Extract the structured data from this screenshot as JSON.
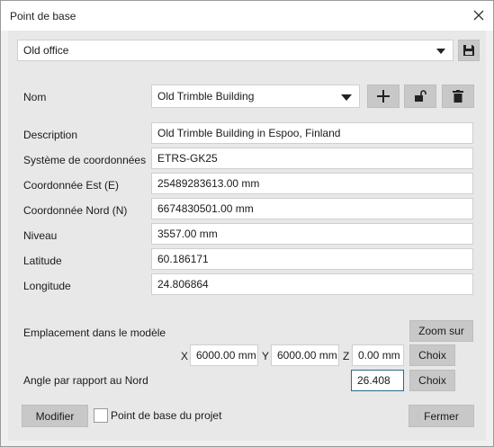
{
  "window": {
    "title": "Point de base"
  },
  "preset": {
    "value": "Old office"
  },
  "form": {
    "name_label": "Nom",
    "name_value": "Old Trimble Building",
    "fields": [
      {
        "label": "Description",
        "value": "Old Trimble Building in Espoo, Finland"
      },
      {
        "label": "Système de coordonnées",
        "value": "ETRS-GK25"
      },
      {
        "label": "Coordonnée Est  (E)",
        "value": "25489283613.00 mm"
      },
      {
        "label": "Coordonnée Nord  (N)",
        "value": "6674830501.00 mm"
      },
      {
        "label": "Niveau",
        "value": "3557.00 mm"
      },
      {
        "label": "Latitude",
        "value": "60.186171"
      },
      {
        "label": "Longitude",
        "value": "24.806864"
      }
    ]
  },
  "location": {
    "label": "Emplacement dans le modèle",
    "zoom_label": "Zoom sur",
    "x_label": "X",
    "x_value": "6000.00 mm",
    "y_label": "Y",
    "y_value": "6000.00 mm",
    "z_label": "Z",
    "z_value": "0.00 mm",
    "pick_label": "Choix"
  },
  "angle": {
    "label": "Angle par rapport au Nord",
    "value": "26.408",
    "pick_label": "Choix"
  },
  "footer": {
    "modify_label": "Modifier",
    "project_base_label": "Point de base du projet",
    "close_label": "Fermer"
  },
  "icons": [
    "close-icon",
    "save-icon",
    "chevron-down-icon",
    "plus-icon",
    "unlock-icon",
    "trash-icon"
  ]
}
